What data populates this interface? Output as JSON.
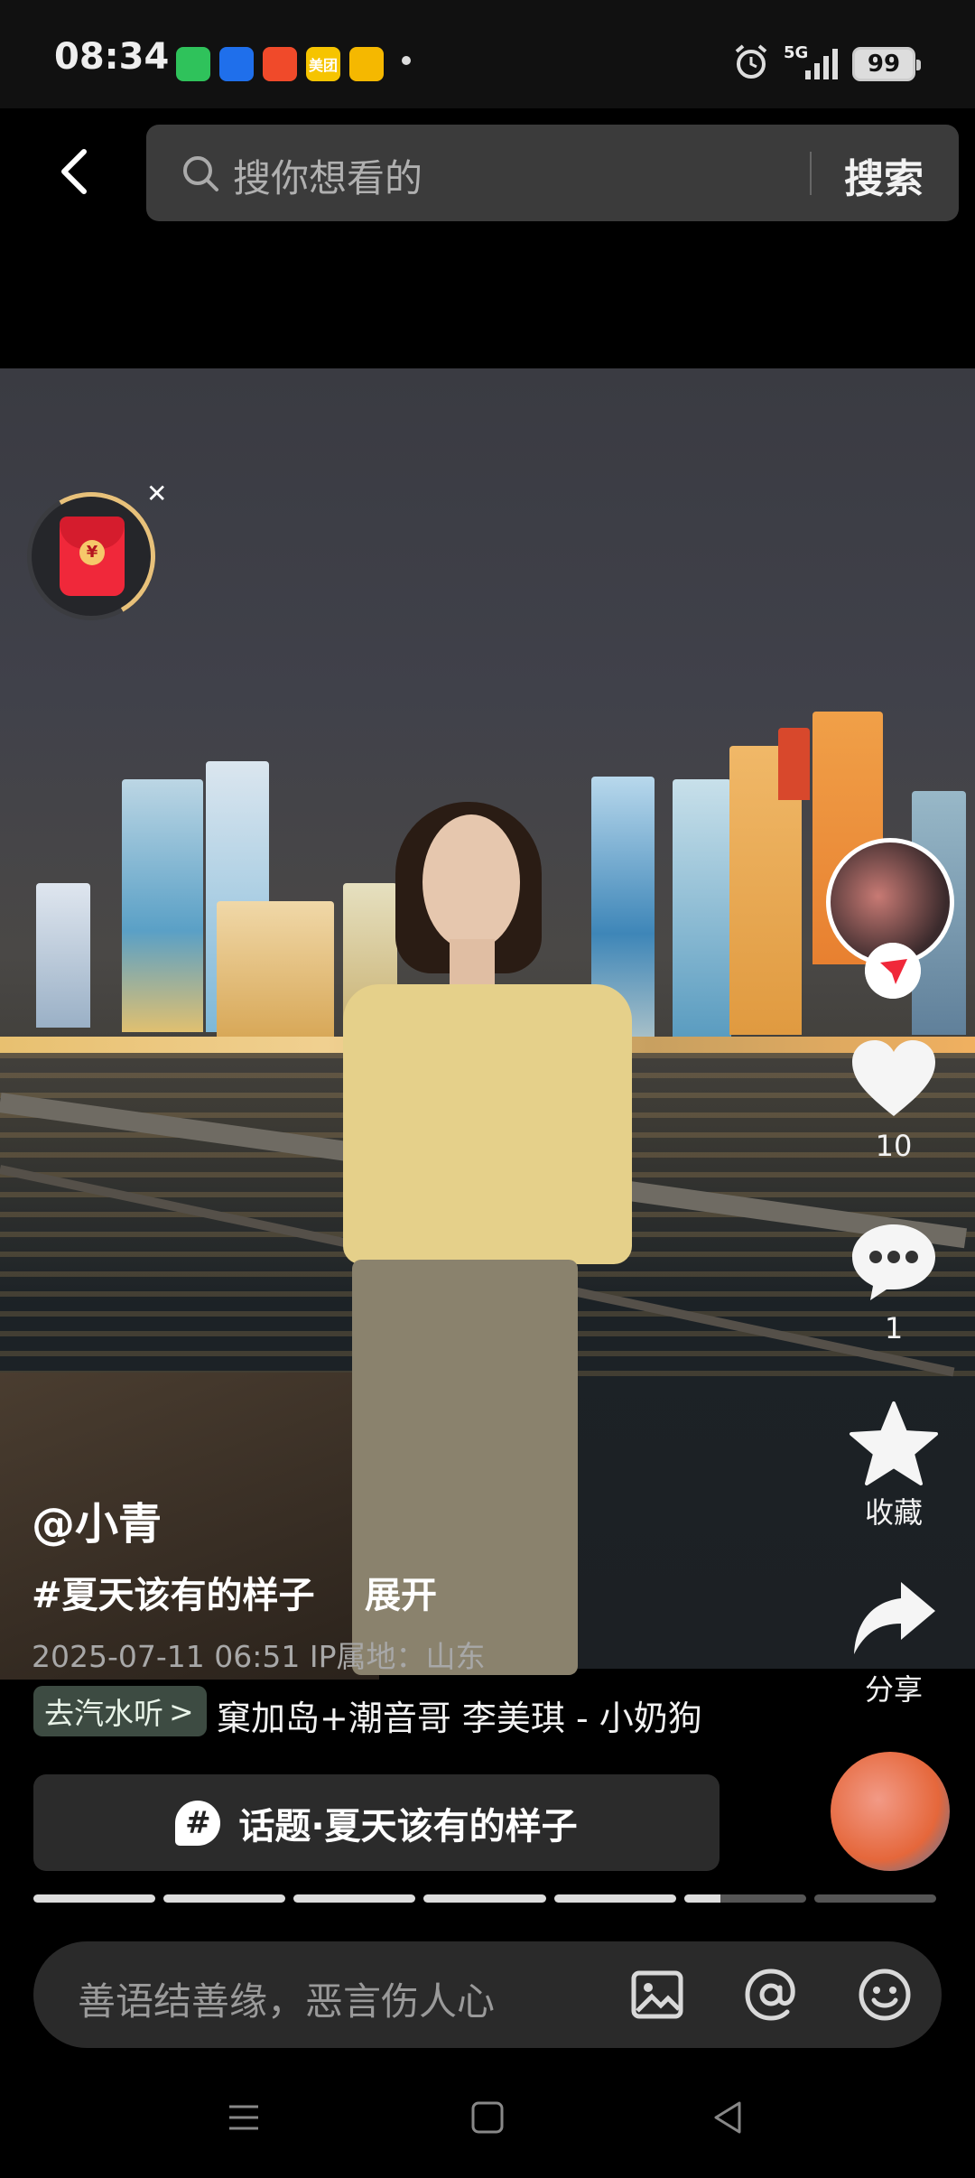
{
  "status_bar": {
    "time": "08:34",
    "apps": [
      {
        "icon": "wechat-icon",
        "color": "#2fc25b",
        "label": ""
      },
      {
        "icon": "feishu-icon",
        "color": "#1f6feb",
        "label": ""
      },
      {
        "icon": "video-app-icon",
        "color": "#f04a2a",
        "label": ""
      },
      {
        "icon": "meituan-icon",
        "color": "#f6c400",
        "label": "美团"
      },
      {
        "icon": "weibo-icon",
        "color": "#f5b800",
        "label": ""
      }
    ],
    "network": "5G",
    "battery": "99"
  },
  "search": {
    "placeholder": "搜你想看的",
    "button": "搜索"
  },
  "video": {
    "red_packet_coin": "¥"
  },
  "actions": {
    "like_count": "10",
    "comment_count": "1",
    "favorite_label": "收藏",
    "share_label": "分享"
  },
  "post": {
    "author": "@小青",
    "hashtag": "#夏天该有的样子",
    "expand": "展开",
    "meta": "2025-07-11 06:51 IP属地：山东"
  },
  "music": {
    "chip_label": "去汽水听",
    "chip_arrow": ">",
    "track": "窠加岛+潮音哥   李美琪 - 小奶狗"
  },
  "topic": {
    "icon_glyph": "#",
    "label": "话题·夏天该有的样子"
  },
  "progress": {
    "segments": [
      1,
      1,
      1,
      1,
      1,
      0.3,
      0
    ]
  },
  "comment": {
    "placeholder": "善语结善缘，恶言伤人心"
  },
  "colors": {
    "accent_red": "#f0283a",
    "follow_badge": "#f0283a"
  }
}
